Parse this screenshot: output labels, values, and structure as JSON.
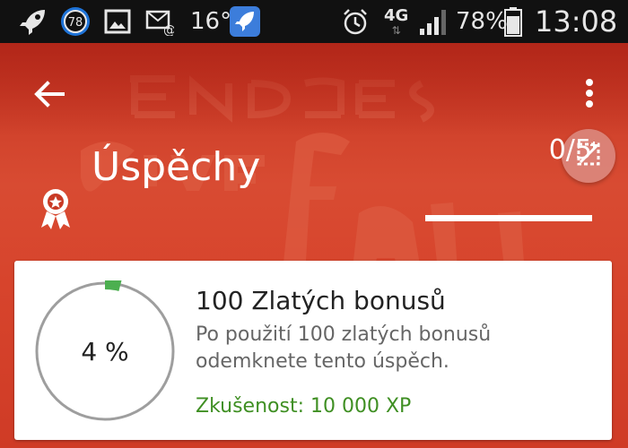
{
  "status_bar": {
    "notification_badge": "78",
    "temperature": "16°",
    "network_type": "4G",
    "battery": "78%",
    "time": "13:08",
    "icons": [
      "rocket-icon",
      "badge-78-icon",
      "image-icon",
      "email-icon",
      "app-rocket-icon",
      "alarm-icon",
      "signal-icon",
      "battery-icon"
    ]
  },
  "header": {
    "back_icon": "back-arrow-icon",
    "menu_icon": "more-vert-icon",
    "title": "Úspěchy",
    "title_icon": "award-ribbon-icon",
    "progress_text": "0/5",
    "progress_fraction": 0.0,
    "fab_icon": "crop-icon"
  },
  "achievement": {
    "percent_label": "4 %",
    "progress_fraction": 0.04,
    "title": "100 Zlatých bonusů",
    "description": "Po použití 100 zlatých bonusů odemknete tento úspěch.",
    "xp": "Zkušenost: 10 000 XP"
  },
  "colors": {
    "accent": "#c93a25",
    "ring": "#9e9e9e",
    "ring_progress": "#4caf50",
    "xp_green": "#3f8f23"
  }
}
